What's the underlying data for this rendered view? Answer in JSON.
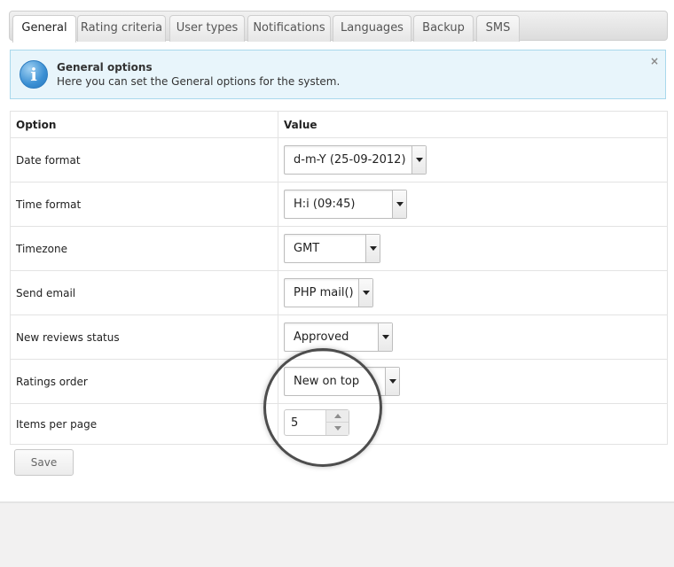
{
  "tabs": [
    {
      "label": "General",
      "active": true
    },
    {
      "label": "Rating criteria",
      "active": false
    },
    {
      "label": "User types",
      "active": false
    },
    {
      "label": "Notifications",
      "active": false
    },
    {
      "label": "Languages",
      "active": false
    },
    {
      "label": "Backup",
      "active": false
    },
    {
      "label": "SMS",
      "active": false
    }
  ],
  "notice": {
    "icon": "info-icon",
    "title": "General options",
    "text": "Here you can set the General options for the system.",
    "close_glyph": "×"
  },
  "table": {
    "headers": {
      "option": "Option",
      "value": "Value"
    },
    "rows": [
      {
        "label": "Date format",
        "value": "d-m-Y (25-09-2012)"
      },
      {
        "label": "Time format",
        "value": "H:i (09:45)"
      },
      {
        "label": "Timezone",
        "value": "GMT"
      },
      {
        "label": "Send email",
        "value": "PHP mail()"
      },
      {
        "label": "New reviews status",
        "value": "Approved"
      },
      {
        "label": "Ratings order",
        "value": "New on top"
      },
      {
        "label": "Items per page",
        "value": "5"
      }
    ]
  },
  "save_label": "Save",
  "colors": {
    "notice_background": "#e8f5fb",
    "notice_border": "#a9d8ec",
    "info_icon": "#3a8fd3",
    "page_background": "#f2f1f1"
  }
}
